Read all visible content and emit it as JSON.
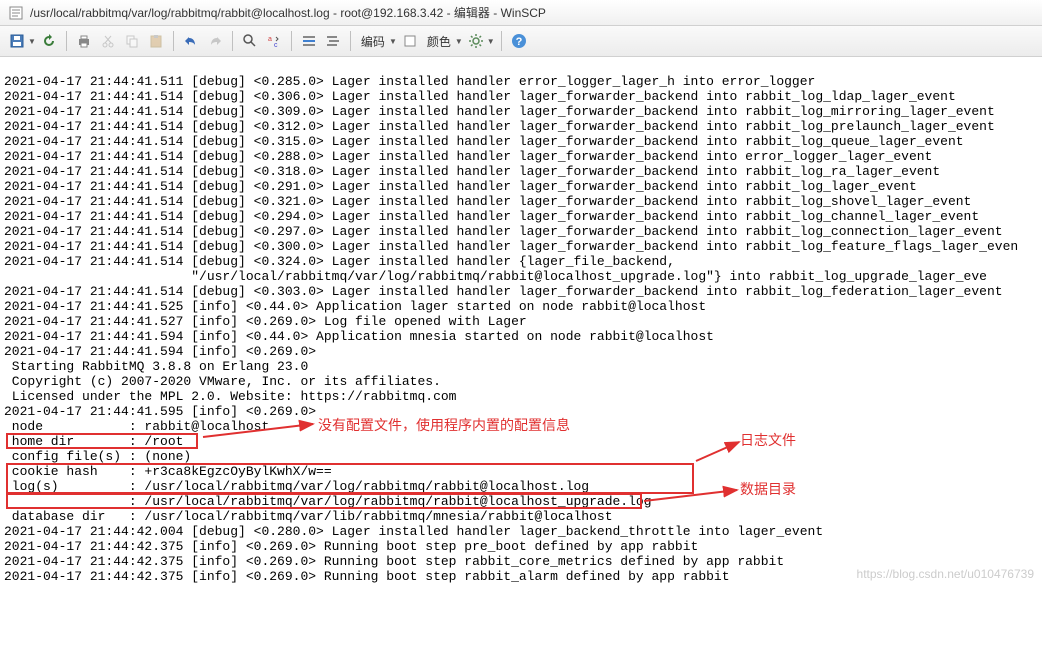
{
  "window": {
    "title": "/usr/local/rabbitmq/var/log/rabbitmq/rabbit@localhost.log - root@192.168.3.42 - 编辑器 - WinSCP"
  },
  "toolbar": {
    "encoding_label": "编码",
    "color_label": "颜色"
  },
  "log_lines": [
    "2021-04-17 21:44:41.511 [debug] <0.285.0> Lager installed handler error_logger_lager_h into error_logger",
    "2021-04-17 21:44:41.514 [debug] <0.306.0> Lager installed handler lager_forwarder_backend into rabbit_log_ldap_lager_event",
    "2021-04-17 21:44:41.514 [debug] <0.309.0> Lager installed handler lager_forwarder_backend into rabbit_log_mirroring_lager_event",
    "2021-04-17 21:44:41.514 [debug] <0.312.0> Lager installed handler lager_forwarder_backend into rabbit_log_prelaunch_lager_event",
    "2021-04-17 21:44:41.514 [debug] <0.315.0> Lager installed handler lager_forwarder_backend into rabbit_log_queue_lager_event",
    "2021-04-17 21:44:41.514 [debug] <0.288.0> Lager installed handler lager_forwarder_backend into error_logger_lager_event",
    "2021-04-17 21:44:41.514 [debug] <0.318.0> Lager installed handler lager_forwarder_backend into rabbit_log_ra_lager_event",
    "2021-04-17 21:44:41.514 [debug] <0.291.0> Lager installed handler lager_forwarder_backend into rabbit_log_lager_event",
    "2021-04-17 21:44:41.514 [debug] <0.321.0> Lager installed handler lager_forwarder_backend into rabbit_log_shovel_lager_event",
    "2021-04-17 21:44:41.514 [debug] <0.294.0> Lager installed handler lager_forwarder_backend into rabbit_log_channel_lager_event",
    "2021-04-17 21:44:41.514 [debug] <0.297.0> Lager installed handler lager_forwarder_backend into rabbit_log_connection_lager_event",
    "2021-04-17 21:44:41.514 [debug] <0.300.0> Lager installed handler lager_forwarder_backend into rabbit_log_feature_flags_lager_even",
    "2021-04-17 21:44:41.514 [debug] <0.324.0> Lager installed handler {lager_file_backend,",
    "                        \"/usr/local/rabbitmq/var/log/rabbitmq/rabbit@localhost_upgrade.log\"} into rabbit_log_upgrade_lager_eve",
    "2021-04-17 21:44:41.514 [debug] <0.303.0> Lager installed handler lager_forwarder_backend into rabbit_log_federation_lager_event",
    "2021-04-17 21:44:41.525 [info] <0.44.0> Application lager started on node rabbit@localhost",
    "2021-04-17 21:44:41.527 [info] <0.269.0> Log file opened with Lager",
    "2021-04-17 21:44:41.594 [info] <0.44.0> Application mnesia started on node rabbit@localhost",
    "2021-04-17 21:44:41.594 [info] <0.269.0>",
    " Starting RabbitMQ 3.8.8 on Erlang 23.0",
    " Copyright (c) 2007-2020 VMware, Inc. or its affiliates.",
    " Licensed under the MPL 2.0. Website: https://rabbitmq.com",
    "2021-04-17 21:44:41.595 [info] <0.269.0>",
    " node           : rabbit@localhost",
    " home dir       : /root",
    " config file(s) : (none)",
    " cookie hash    : +r3ca8kEgzcOyBylKwhX/w==",
    " log(s)         : /usr/local/rabbitmq/var/log/rabbitmq/rabbit@localhost.log",
    "                : /usr/local/rabbitmq/var/log/rabbitmq/rabbit@localhost_upgrade.log",
    " database dir   : /usr/local/rabbitmq/var/lib/rabbitmq/mnesia/rabbit@localhost",
    "2021-04-17 21:44:42.004 [debug] <0.280.0> Lager installed handler lager_backend_throttle into lager_event",
    "2021-04-17 21:44:42.375 [info] <0.269.0> Running boot step pre_boot defined by app rabbit",
    "2021-04-17 21:44:42.375 [info] <0.269.0> Running boot step rabbit_core_metrics defined by app rabbit",
    "2021-04-17 21:44:42.375 [info] <0.269.0> Running boot step rabbit_alarm defined by app rabbit"
  ],
  "annotations": {
    "no_config": "没有配置文件，使用程序内置的配置信息",
    "log_file": "日志文件",
    "data_dir": "数据目录"
  },
  "watermark": "https://blog.csdn.net/u010476739"
}
